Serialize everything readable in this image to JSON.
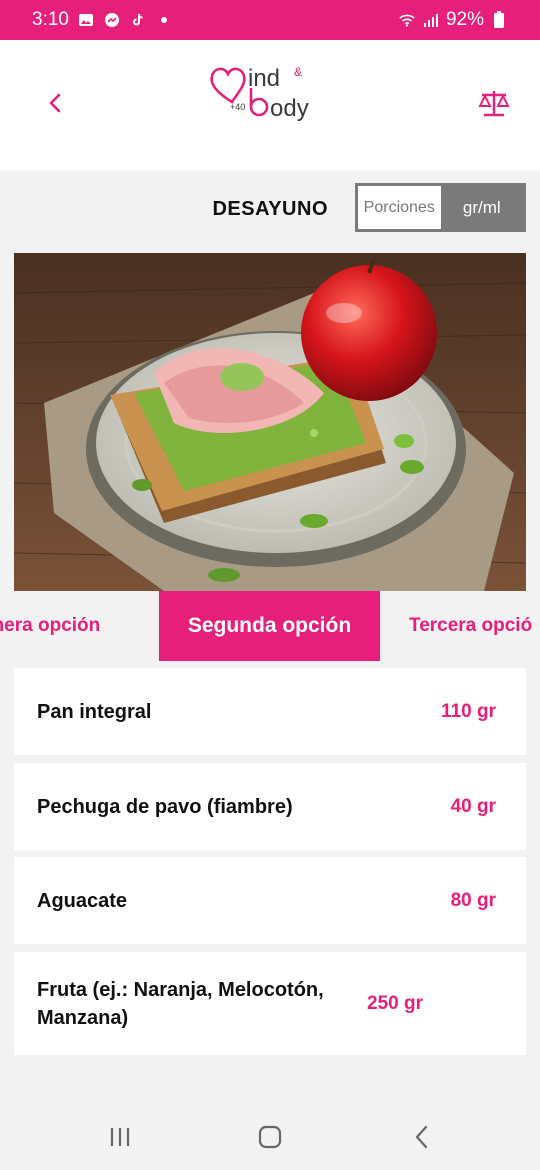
{
  "status_bar": {
    "time": "3:10",
    "notification_icons": [
      "gallery-icon",
      "messenger-icon",
      "tiktok-icon",
      "dot-icon"
    ],
    "battery": "92%"
  },
  "header": {
    "logo": {
      "text_top": "ind",
      "text_amp": "&",
      "text_bottom": "ody",
      "text_small": "+40"
    },
    "back_icon": "chevron-left-icon",
    "scale_icon": "scale-icon",
    "accent_color": "#e6207a"
  },
  "meal": {
    "title": "DESAYUNO",
    "unit_options": [
      "Porciones",
      "gr/ml"
    ],
    "selected_unit": "gr/ml"
  },
  "tabs": [
    {
      "label": "imera opción",
      "selected": false
    },
    {
      "label": "Segunda opción",
      "selected": true
    },
    {
      "label": "Tercera opció",
      "selected": false
    }
  ],
  "ingredients": [
    {
      "name": "Pan integral",
      "qty": "110 gr"
    },
    {
      "name": "Pechuga de pavo (fiambre)",
      "qty": "40 gr"
    },
    {
      "name": "Aguacate",
      "qty": "80 gr"
    },
    {
      "name": "Fruta (ej.: Naranja, Melocotón, Manzana)",
      "qty": "250 gr"
    }
  ]
}
